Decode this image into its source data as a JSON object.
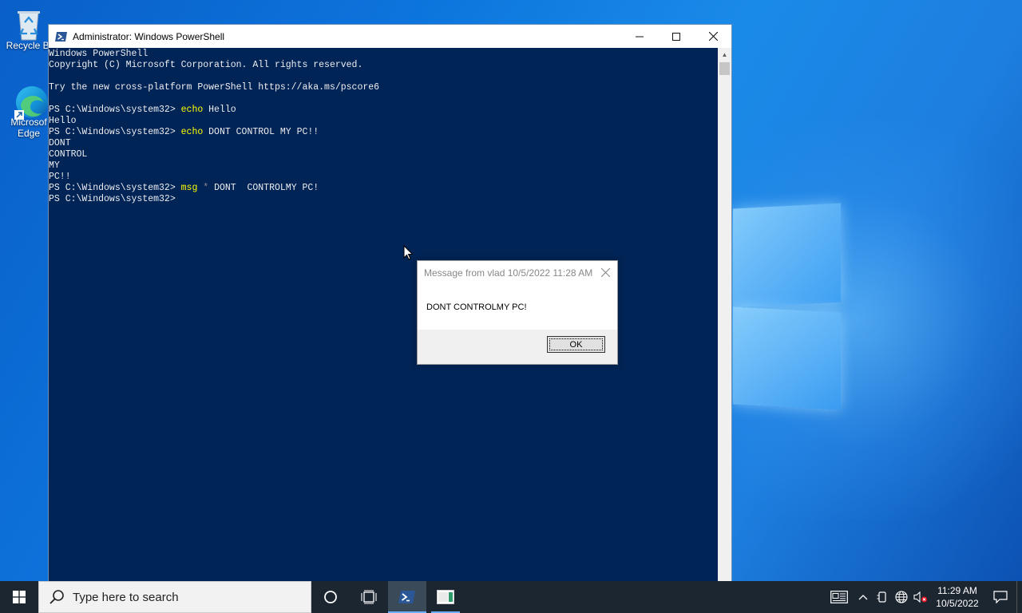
{
  "desktop": {
    "icons": [
      {
        "label": "Recycle Bin",
        "display": "Recycle Bi"
      },
      {
        "label": "Microsoft Edge",
        "display_line1": "Microsof",
        "display_line2": "Edge"
      }
    ]
  },
  "powershell": {
    "title": "Administrator: Windows PowerShell",
    "lines": [
      [
        {
          "t": "Windows PowerShell"
        }
      ],
      [
        {
          "t": "Copyright (C) Microsoft Corporation. All rights reserved."
        }
      ],
      [
        {
          "t": ""
        }
      ],
      [
        {
          "t": "Try the new cross-platform PowerShell https://aka.ms/pscore6"
        }
      ],
      [
        {
          "t": ""
        }
      ],
      [
        {
          "t": "PS C:\\Windows\\system32> "
        },
        {
          "t": "echo",
          "c": "cmd"
        },
        {
          "t": " Hello"
        }
      ],
      [
        {
          "t": "Hello"
        }
      ],
      [
        {
          "t": "PS C:\\Windows\\system32> "
        },
        {
          "t": "echo",
          "c": "cmd"
        },
        {
          "t": " DONT CONTROL MY PC!!"
        }
      ],
      [
        {
          "t": "DONT"
        }
      ],
      [
        {
          "t": "CONTROL"
        }
      ],
      [
        {
          "t": "MY"
        }
      ],
      [
        {
          "t": "PC!!"
        }
      ],
      [
        {
          "t": "PS C:\\Windows\\system32> "
        },
        {
          "t": "msg",
          "c": "cmd"
        },
        {
          "t": " "
        },
        {
          "t": "*",
          "c": "op"
        },
        {
          "t": " DONT  CONTROLMY PC!"
        }
      ],
      [
        {
          "t": "PS C:\\Windows\\system32> "
        }
      ]
    ],
    "colors": {
      "background": "#012456",
      "text": "#eeedf0",
      "command": "#ffff00"
    }
  },
  "dialog": {
    "title": "Message from vlad 10/5/2022 11:28 AM",
    "message": "DONT CONTROLMY PC!",
    "ok_label": "OK"
  },
  "taskbar": {
    "search_placeholder": "Type here to search",
    "apps": [
      {
        "icon": "cortana-icon"
      },
      {
        "icon": "task-view-icon"
      },
      {
        "icon": "powershell-icon",
        "state": "active"
      },
      {
        "icon": "app-window-icon",
        "state": "open"
      }
    ],
    "tray_icons": [
      "news-icon",
      "chevron-up-icon",
      "device-icon",
      "network-icon",
      "volume-muted-icon"
    ],
    "clock_time": "11:29 AM",
    "clock_date": "10/5/2022"
  }
}
